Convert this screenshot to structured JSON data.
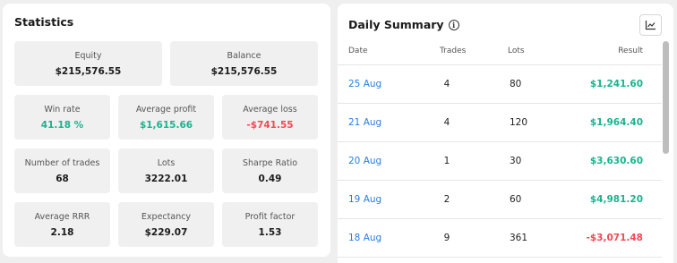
{
  "statistics": {
    "title": "Statistics",
    "equity": {
      "label": "Equity",
      "value": "$215,576.55"
    },
    "balance": {
      "label": "Balance",
      "value": "$215,576.55"
    },
    "win_rate": {
      "label": "Win rate",
      "value": "41.18 %"
    },
    "average_profit": {
      "label": "Average profit",
      "value": "$1,615.66"
    },
    "average_loss": {
      "label": "Average loss",
      "value": "-$741.55"
    },
    "number_of_trades": {
      "label": "Number of trades",
      "value": "68"
    },
    "lots": {
      "label": "Lots",
      "value": "3222.01"
    },
    "sharpe_ratio": {
      "label": "Sharpe Ratio",
      "value": "0.49"
    },
    "average_rrr": {
      "label": "Average RRR",
      "value": "2.18"
    },
    "expectancy": {
      "label": "Expectancy",
      "value": "$229.07"
    },
    "profit_factor": {
      "label": "Profit factor",
      "value": "1.53"
    }
  },
  "daily_summary": {
    "title": "Daily Summary",
    "info_icon": "info-icon",
    "chart_icon": "line-chart-icon",
    "columns": {
      "date": "Date",
      "trades": "Trades",
      "lots": "Lots",
      "result": "Result"
    },
    "rows": [
      {
        "date": "25 Aug",
        "trades": "4",
        "lots": "80",
        "result": "$1,241.60",
        "status": "profit"
      },
      {
        "date": "21 Aug",
        "trades": "4",
        "lots": "120",
        "result": "$1,964.40",
        "status": "profit"
      },
      {
        "date": "20 Aug",
        "trades": "1",
        "lots": "30",
        "result": "$3,630.60",
        "status": "profit"
      },
      {
        "date": "19 Aug",
        "trades": "2",
        "lots": "60",
        "result": "$4,981.20",
        "status": "profit"
      },
      {
        "date": "18 Aug",
        "trades": "9",
        "lots": "361",
        "result": "-$3,071.48",
        "status": "loss"
      }
    ]
  },
  "colors": {
    "profit": "#1bb38f",
    "loss": "#f04a55",
    "link": "#2a7de1"
  }
}
